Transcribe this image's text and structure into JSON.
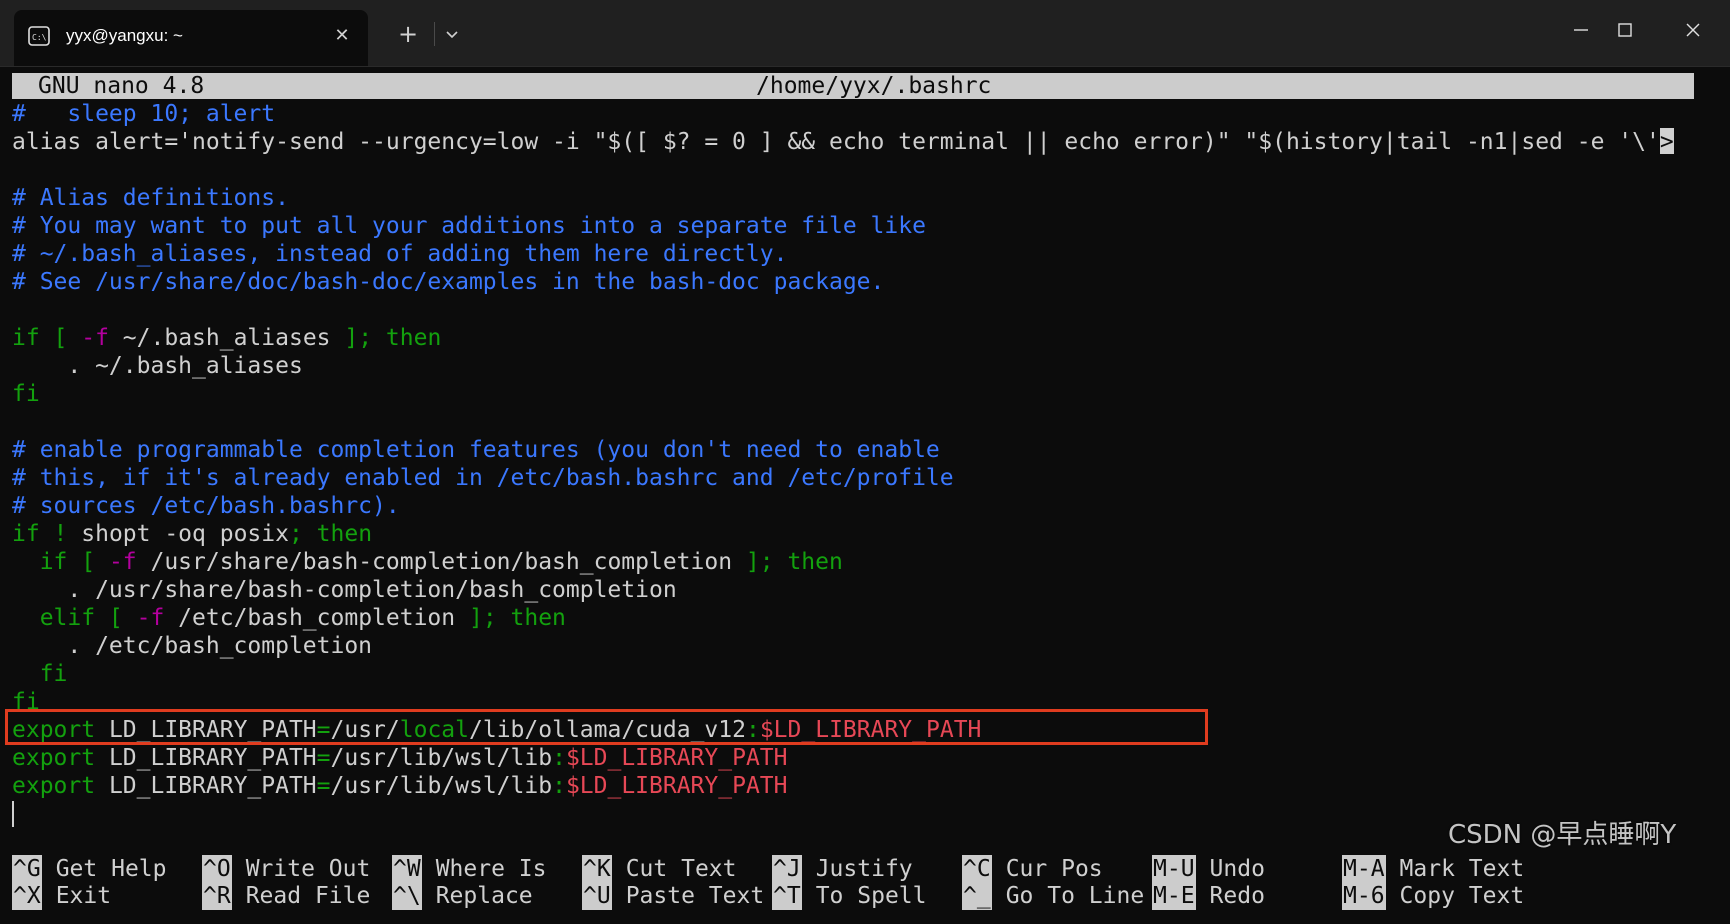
{
  "window": {
    "tab_title": "yyx@yangxu: ~",
    "tab_icon": "terminal-icon",
    "close_tab_glyph": "✕",
    "new_tab_glyph": "+"
  },
  "nano": {
    "version": "GNU nano 4.8",
    "filename": "/home/yyx/.bashrc"
  },
  "lines": [
    [
      {
        "t": "#   sleep 10; alert",
        "c": "cmt"
      }
    ],
    [
      {
        "t": "alias alert='notify-send --urgency=low -i \"$([ $? = 0 ] && echo terminal || echo error)\" \"$(history|tail -n1|sed -e '\\'"
      },
      {
        "t": ">",
        "c": "cursor"
      }
    ],
    [],
    [
      {
        "t": "# Alias definitions.",
        "c": "cmt"
      }
    ],
    [
      {
        "t": "# You may want to put all your additions into a separate file like",
        "c": "cmt"
      }
    ],
    [
      {
        "t": "# ~/.bash_aliases, instead of adding them here directly.",
        "c": "cmt"
      }
    ],
    [
      {
        "t": "# See /usr/share/doc/bash-doc/examples in the bash-doc package.",
        "c": "cmt"
      }
    ],
    [],
    [
      {
        "t": "if [ ",
        "c": "kw"
      },
      {
        "t": "-f",
        "c": "flag"
      },
      {
        "t": " ~/.bash_aliases "
      },
      {
        "t": "]; then",
        "c": "kw"
      }
    ],
    [
      {
        "t": "    . ~/.bash_aliases"
      }
    ],
    [
      {
        "t": "fi",
        "c": "kw"
      }
    ],
    [],
    [
      {
        "t": "# enable programmable completion features (you don't need to enable",
        "c": "cmt"
      }
    ],
    [
      {
        "t": "# this, if it's already enabled in /etc/bash.bashrc and /etc/profile",
        "c": "cmt"
      }
    ],
    [
      {
        "t": "# sources /etc/bash.bashrc).",
        "c": "cmt"
      }
    ],
    [
      {
        "t": "if ! ",
        "c": "kw"
      },
      {
        "t": "shopt -oq posix"
      },
      {
        "t": "; then",
        "c": "kw"
      }
    ],
    [
      {
        "t": "  if [ ",
        "c": "kw"
      },
      {
        "t": "-f",
        "c": "flag"
      },
      {
        "t": " /usr/share/bash-completion/bash_completion "
      },
      {
        "t": "]; then",
        "c": "kw"
      }
    ],
    [
      {
        "t": "    . /usr/share/bash-completion/bash_completion"
      }
    ],
    [
      {
        "t": "  elif [ ",
        "c": "kw"
      },
      {
        "t": "-f",
        "c": "flag"
      },
      {
        "t": " /etc/bash_completion "
      },
      {
        "t": "]; then",
        "c": "kw"
      }
    ],
    [
      {
        "t": "    . /etc/bash_completion"
      }
    ],
    [
      {
        "t": "  fi",
        "c": "kw"
      }
    ],
    [
      {
        "t": "fi",
        "c": "kw"
      }
    ],
    [
      {
        "t": "export",
        "c": "kw"
      },
      {
        "t": " LD_LIBRARY_PATH"
      },
      {
        "t": "=",
        "c": "kw"
      },
      {
        "t": "/usr/"
      },
      {
        "t": "local",
        "c": "kw"
      },
      {
        "t": "/lib/ollama/cuda_v12"
      },
      {
        "t": ":",
        "c": "kw"
      },
      {
        "t": "$LD_LIBRARY_PATH",
        "c": "var"
      }
    ],
    [
      {
        "t": "export",
        "c": "kw"
      },
      {
        "t": " LD_LIBRARY_PATH"
      },
      {
        "t": "=",
        "c": "kw"
      },
      {
        "t": "/usr/lib/wsl/lib"
      },
      {
        "t": ":",
        "c": "kw"
      },
      {
        "t": "$LD_LIBRARY_PATH",
        "c": "var"
      }
    ],
    [
      {
        "t": "export",
        "c": "kw"
      },
      {
        "t": " LD_LIBRARY_PATH"
      },
      {
        "t": "=",
        "c": "kw"
      },
      {
        "t": "/usr/lib/wsl/lib"
      },
      {
        "t": ":",
        "c": "kw"
      },
      {
        "t": "$LD_LIBRARY_PATH",
        "c": "var"
      }
    ]
  ],
  "shortcuts": [
    {
      "key": "^G",
      "label": "Get Help"
    },
    {
      "key": "^X",
      "label": "Exit"
    },
    {
      "key": "^O",
      "label": "Write Out"
    },
    {
      "key": "^R",
      "label": "Read File"
    },
    {
      "key": "^W",
      "label": "Where Is"
    },
    {
      "key": "^\\",
      "label": "Replace"
    },
    {
      "key": "^K",
      "label": "Cut Text"
    },
    {
      "key": "^U",
      "label": "Paste Text"
    },
    {
      "key": "^J",
      "label": "Justify"
    },
    {
      "key": "^T",
      "label": "To Spell"
    },
    {
      "key": "^C",
      "label": "Cur Pos"
    },
    {
      "key": "^_",
      "label": "Go To Line"
    },
    {
      "key": "M-U",
      "label": "Undo"
    },
    {
      "key": "M-E",
      "label": "Redo"
    },
    {
      "key": "M-A",
      "label": "Mark Text"
    },
    {
      "key": "M-6",
      "label": "Copy Text"
    }
  ],
  "watermark": "CSDN @早点睡啊Y",
  "colors": {
    "comment": "#3b78ff",
    "keyword": "#13a10e",
    "variable": "#e74856",
    "flag": "#b4009e",
    "highlight_box": "#e03c1f"
  }
}
